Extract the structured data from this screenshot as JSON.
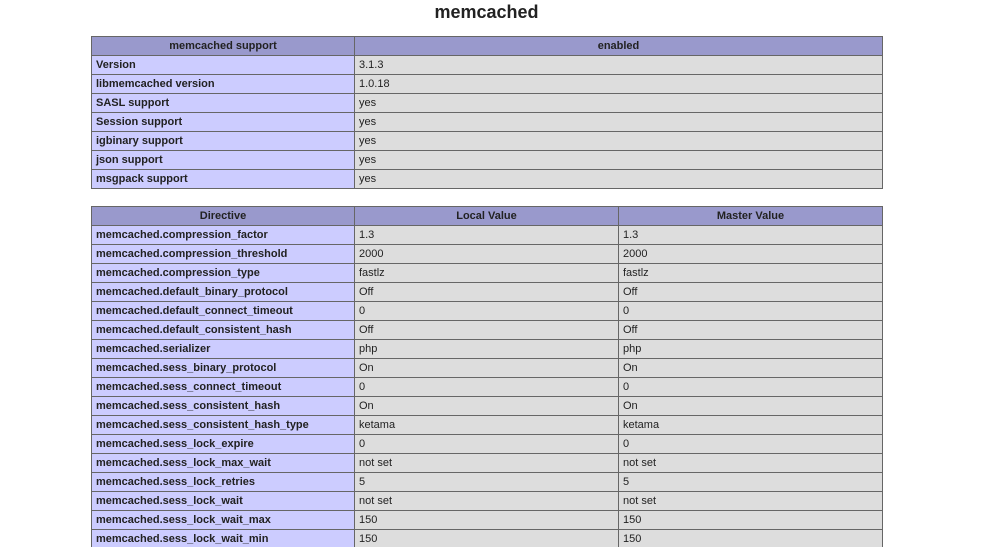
{
  "section": {
    "title": "memcached"
  },
  "support_table": {
    "headers": [
      "memcached support",
      "enabled"
    ],
    "rows": [
      [
        "Version",
        "3.1.3"
      ],
      [
        "libmemcached version",
        "1.0.18"
      ],
      [
        "SASL support",
        "yes"
      ],
      [
        "Session support",
        "yes"
      ],
      [
        "igbinary support",
        "yes"
      ],
      [
        "json support",
        "yes"
      ],
      [
        "msgpack support",
        "yes"
      ]
    ]
  },
  "directive_table": {
    "headers": [
      "Directive",
      "Local Value",
      "Master Value"
    ],
    "rows": [
      [
        "memcached.compression_factor",
        "1.3",
        "1.3"
      ],
      [
        "memcached.compression_threshold",
        "2000",
        "2000"
      ],
      [
        "memcached.compression_type",
        "fastlz",
        "fastlz"
      ],
      [
        "memcached.default_binary_protocol",
        "Off",
        "Off"
      ],
      [
        "memcached.default_connect_timeout",
        "0",
        "0"
      ],
      [
        "memcached.default_consistent_hash",
        "Off",
        "Off"
      ],
      [
        "memcached.serializer",
        "php",
        "php"
      ],
      [
        "memcached.sess_binary_protocol",
        "On",
        "On"
      ],
      [
        "memcached.sess_connect_timeout",
        "0",
        "0"
      ],
      [
        "memcached.sess_consistent_hash",
        "On",
        "On"
      ],
      [
        "memcached.sess_consistent_hash_type",
        "ketama",
        "ketama"
      ],
      [
        "memcached.sess_lock_expire",
        "0",
        "0"
      ],
      [
        "memcached.sess_lock_max_wait",
        "not set",
        "not set"
      ],
      [
        "memcached.sess_lock_retries",
        "5",
        "5"
      ],
      [
        "memcached.sess_lock_wait",
        "not set",
        "not set"
      ],
      [
        "memcached.sess_lock_wait_max",
        "150",
        "150"
      ],
      [
        "memcached.sess_lock_wait_min",
        "150",
        "150"
      ]
    ]
  }
}
